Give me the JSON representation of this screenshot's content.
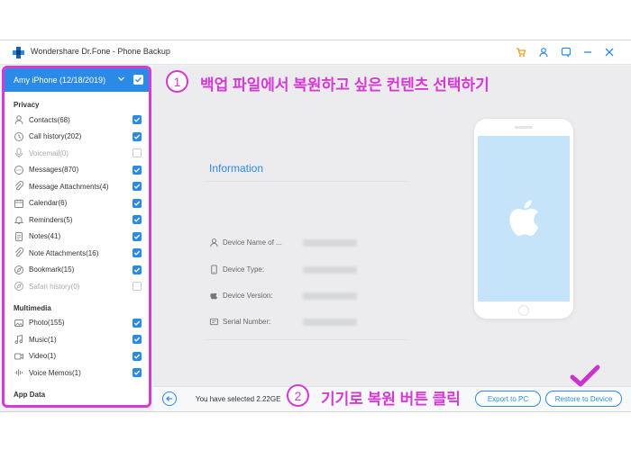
{
  "app": {
    "title": "Wondershare Dr.Fone - Phone Backup"
  },
  "device": {
    "label": "Amy iPhone (12/18/2019)"
  },
  "sections": [
    {
      "name": "Privacy",
      "items": [
        {
          "label": "Contacts(68)",
          "icon": "contacts-icon",
          "checked": true
        },
        {
          "label": "Call history(202)",
          "icon": "call-history-icon",
          "checked": true
        },
        {
          "label": "Voicemail(0)",
          "icon": "voicemail-icon",
          "checked": false
        },
        {
          "label": "Messages(870)",
          "icon": "messages-icon",
          "checked": true
        },
        {
          "label": "Message Attachments(4)",
          "icon": "attachment-icon",
          "checked": true
        },
        {
          "label": "Calendar(6)",
          "icon": "calendar-icon",
          "checked": true
        },
        {
          "label": "Reminders(5)",
          "icon": "reminders-icon",
          "checked": true
        },
        {
          "label": "Notes(41)",
          "icon": "notes-icon",
          "checked": true
        },
        {
          "label": "Note Attachments(16)",
          "icon": "note-attachment-icon",
          "checked": true
        },
        {
          "label": "Bookmark(15)",
          "icon": "bookmark-icon",
          "checked": true
        },
        {
          "label": "Safari history(0)",
          "icon": "safari-icon",
          "checked": false
        }
      ]
    },
    {
      "name": "Multimedia",
      "items": [
        {
          "label": "Photo(155)",
          "icon": "photo-icon",
          "checked": true
        },
        {
          "label": "Music(1)",
          "icon": "music-icon",
          "checked": true
        },
        {
          "label": "Video(1)",
          "icon": "video-icon",
          "checked": true
        },
        {
          "label": "Voice Memos(1)",
          "icon": "voice-memo-icon",
          "checked": true
        }
      ]
    },
    {
      "name": "App Data",
      "items": []
    }
  ],
  "info": {
    "title": "Information",
    "rows": [
      {
        "label": "Device Name of ...",
        "icon": "user-icon"
      },
      {
        "label": "Device Type:",
        "icon": "phone-icon"
      },
      {
        "label": "Device Version:",
        "icon": "apple-icon"
      },
      {
        "label": "Serial Number:",
        "icon": "serial-icon"
      }
    ]
  },
  "footer": {
    "selected_text": "You have selected 2.22GE",
    "export_label": "Export to PC",
    "restore_label": "Restore to Device"
  },
  "annotations": {
    "step1_num": "1",
    "step1_text": "백업 파일에서 복원하고 싶은 컨텐츠 선택하기",
    "step2_num": "2",
    "step2_text": "기기로 복원 버튼 클릭"
  },
  "colors": {
    "accent": "#2b8ae6",
    "annotation": "#d63ad6",
    "check": "#cc33cc"
  }
}
